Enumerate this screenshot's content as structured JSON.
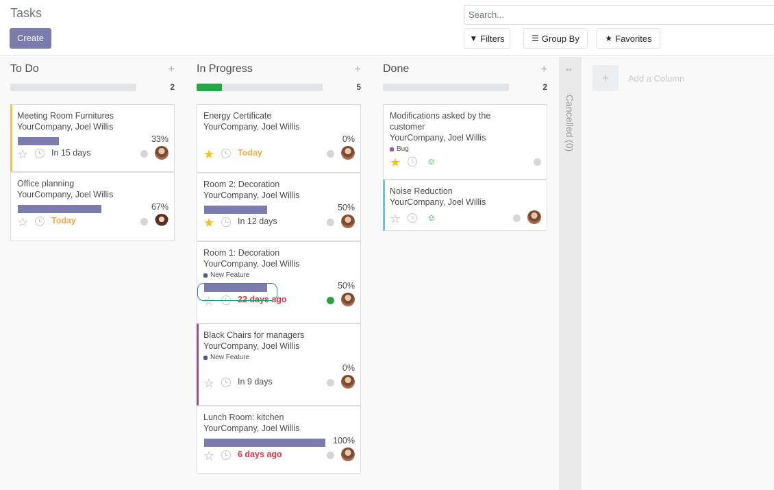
{
  "header": {
    "title": "Tasks",
    "create_label": "Create",
    "search_placeholder": "Search...",
    "filters_label": "Filters",
    "groupby_label": "Group By",
    "favorites_label": "Favorites"
  },
  "columns": [
    {
      "title": "To Do",
      "count": "2",
      "progress": 0,
      "cards": [
        {
          "name": "Meeting Room Furnitures",
          "company": "YourCompany, Joel Willis",
          "progress": 33,
          "progress_label": "33%",
          "starred": false,
          "deadline": "In 15 days",
          "deadline_style": "normal",
          "avatar": "male"
        },
        {
          "name": "Office planning",
          "company": "YourCompany, Joel Willis",
          "progress": 67,
          "progress_label": "67%",
          "starred": false,
          "deadline": "Today",
          "deadline_style": "warn",
          "avatar": "female"
        }
      ]
    },
    {
      "title": "In Progress",
      "count": "5",
      "progress": 20,
      "cards": [
        {
          "name": "Energy Certificate",
          "company": "YourCompany, Joel Willis",
          "progress": 0,
          "progress_label": "0%",
          "starred": true,
          "deadline": "Today",
          "deadline_style": "warn",
          "avatar": "male"
        },
        {
          "name": "Room 2: Decoration",
          "company": "YourCompany, Joel Willis",
          "progress": 50,
          "progress_label": "50%",
          "starred": true,
          "deadline": "In 12 days",
          "deadline_style": "normal",
          "avatar": "male"
        },
        {
          "name": "Room 1: Decoration",
          "company": "YourCompany, Joel Willis",
          "tag": "New Feature",
          "progress": 50,
          "progress_label": "50%",
          "starred": false,
          "deadline": "22 days ago",
          "deadline_style": "late",
          "state": "green",
          "avatar": "male"
        },
        {
          "name": "Black Chairs for managers",
          "company": "YourCompany, Joel Willis",
          "tag": "New Feature",
          "progress": 0,
          "progress_label": "0%",
          "starred": false,
          "deadline": "In 9 days",
          "deadline_style": "normal",
          "avatar": "male"
        },
        {
          "name": "Lunch Room: kitchen",
          "company": "YourCompany, Joel Willis",
          "progress": 100,
          "progress_label": "100%",
          "starred": false,
          "deadline": "6 days ago",
          "deadline_style": "late",
          "avatar": "male"
        }
      ]
    },
    {
      "title": "Done",
      "count": "2",
      "progress": 0,
      "cards": [
        {
          "name_line1": "Modifications asked by the",
          "name_line2": "customer",
          "company": "YourCompany, Joel Willis",
          "tag": "Bug",
          "starred": true
        },
        {
          "name": "Noise Reduction",
          "company": "YourCompany, Joel Willis",
          "starred": false,
          "avatar": "male"
        }
      ]
    }
  ],
  "folded": {
    "label": "Cancelled (0)"
  },
  "add_column_label": "Add a Column",
  "colors": {
    "primary": "#7c7bad",
    "star": "#f3c11a",
    "late": "#dc3545",
    "warn": "#f0ad4e",
    "done": "#28a745",
    "tag_feature": "#4c5b7a",
    "tag_bug": "#9b59b6"
  }
}
